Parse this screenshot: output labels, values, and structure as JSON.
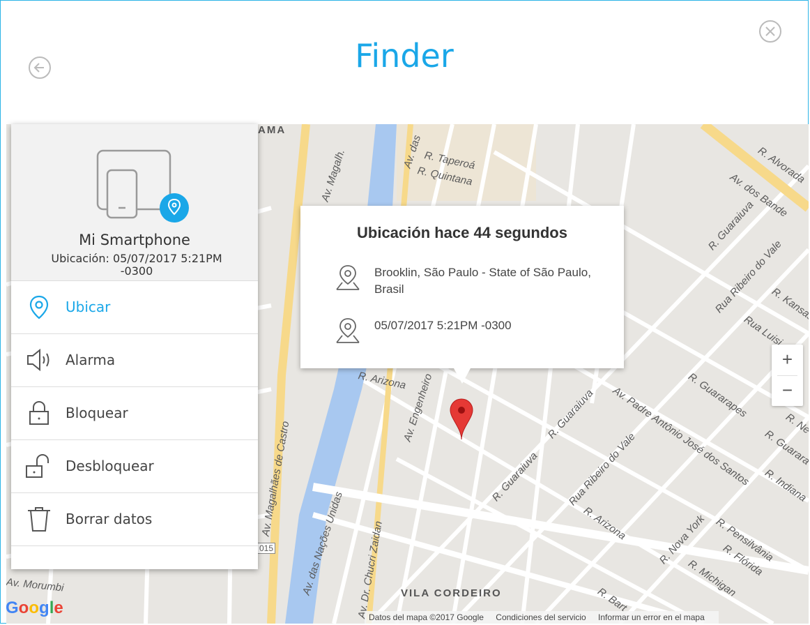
{
  "window": {
    "title": "Finder"
  },
  "device": {
    "name": "Mi Smartphone",
    "location": "Ubicación: 05/07/2017 5:21PM -0300"
  },
  "menu": [
    {
      "label": "Ubicar",
      "icon": "location-pin-icon",
      "active": true
    },
    {
      "label": "Alarma",
      "icon": "speaker-icon"
    },
    {
      "label": "Bloquear",
      "icon": "lock-icon"
    },
    {
      "label": "Desbloquear",
      "icon": "unlock-icon"
    },
    {
      "label": "Borrar datos",
      "icon": "trash-icon"
    }
  ],
  "popup": {
    "title": "Ubicación hace 44 segundos",
    "address": "Brooklin, São Paulo - State of São Paulo, Brasil",
    "timestamp": "05/07/2017 5:21PM -0300"
  },
  "map": {
    "labels": {
      "panorama": "NANORAMA",
      "magalh": "Av. Magalh.",
      "das": "Av. das",
      "taperoa": "R. Taperoá",
      "quintana": "R. Quintana",
      "alvorada": "R. Alvorada",
      "bandeirantes": "Av. dos Bande",
      "guaraiuva1": "R. Guaraiuva",
      "ribeiro1": "Rua Ribeiro do Vale",
      "arizona1": "R. Arizona",
      "engenheiro": "Av. Engenheiro",
      "castro": "Av. Magalhães de Castro",
      "nacoes": "Av. das Nações Unidas",
      "chucri": "Av. Dr. Chucri Zaidan",
      "morumbi": "Av. Morumbi",
      "vila": "VILA CORDEIRO",
      "padre": "Av. Padre Antônio José dos Santos",
      "guararapes": "R. Guararapes",
      "luisi": "Rua Luisi",
      "kansas": "R. Kansas",
      "nova_york": "R. Nova York",
      "pensilvania": "R. Pensilvânia",
      "florida": "R. Flórida",
      "michigan": "R. Michigan",
      "indiana": "R. Indiana",
      "arizona2": "R. Arizona",
      "ribeiro2": "Rua Ribeiro do Vale",
      "guaraiuva2": "R. Guaraiuva",
      "guaraiuva3": "R. Guaraiuva",
      "bart": "R. Bart",
      "highway": "015",
      "guarar2": "R. Guarara",
      "ne": "R. Ne"
    },
    "zoom_in": "+",
    "zoom_out": "−",
    "attribution": [
      "Datos del mapa ©2017 Google",
      "Condiciones del servicio",
      "Informar un error en el mapa"
    ],
    "logo": [
      "G",
      "o",
      "o",
      "g",
      "l",
      "e"
    ]
  },
  "colors": {
    "accent": "#1aa7e8",
    "marker": "#e53935",
    "river": "#a8c8f0",
    "highway": "#f7d98a"
  }
}
